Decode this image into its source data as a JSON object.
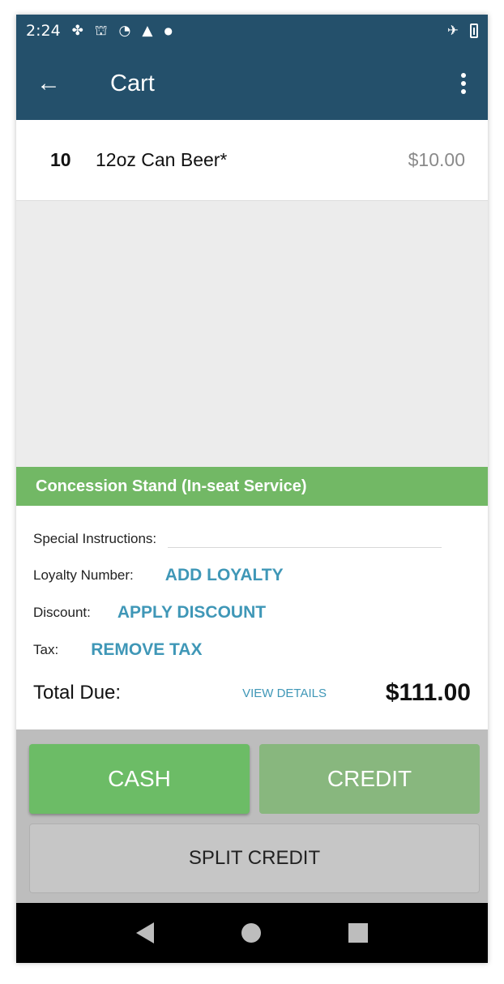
{
  "status_bar": {
    "time": "2:24",
    "icons": [
      "app-icon",
      "cast-icon",
      "wifi-icon",
      "warning-icon",
      "dot-icon"
    ],
    "right_icons": [
      "airplane-icon",
      "battery-icon"
    ]
  },
  "app_bar": {
    "title": "Cart",
    "back_icon": "arrow-left-icon",
    "menu_icon": "more-vertical-icon"
  },
  "cart": {
    "items": [
      {
        "qty": "10",
        "name": "12oz Can Beer*",
        "price": "$10.00"
      }
    ]
  },
  "summary": {
    "section_title": "Concession Stand (In-seat Service)",
    "special_instructions_label": "Special Instructions:",
    "special_instructions_value": "",
    "loyalty_label": "Loyalty Number:",
    "loyalty_action": "ADD LOYALTY",
    "discount_label": "Discount:",
    "discount_action": "APPLY DISCOUNT",
    "tax_label": "Tax:",
    "tax_action": "REMOVE TAX",
    "total_label": "Total Due:",
    "view_details": "VIEW DETAILS",
    "total_amount": "$111.00"
  },
  "payment": {
    "cash": "CASH",
    "credit": "CREDIT",
    "split_credit": "SPLIT CREDIT"
  },
  "colors": {
    "primary": "#24506b",
    "section_green": "#72b865",
    "link_blue": "#3f97b7",
    "cash_green": "#6cbc66"
  }
}
